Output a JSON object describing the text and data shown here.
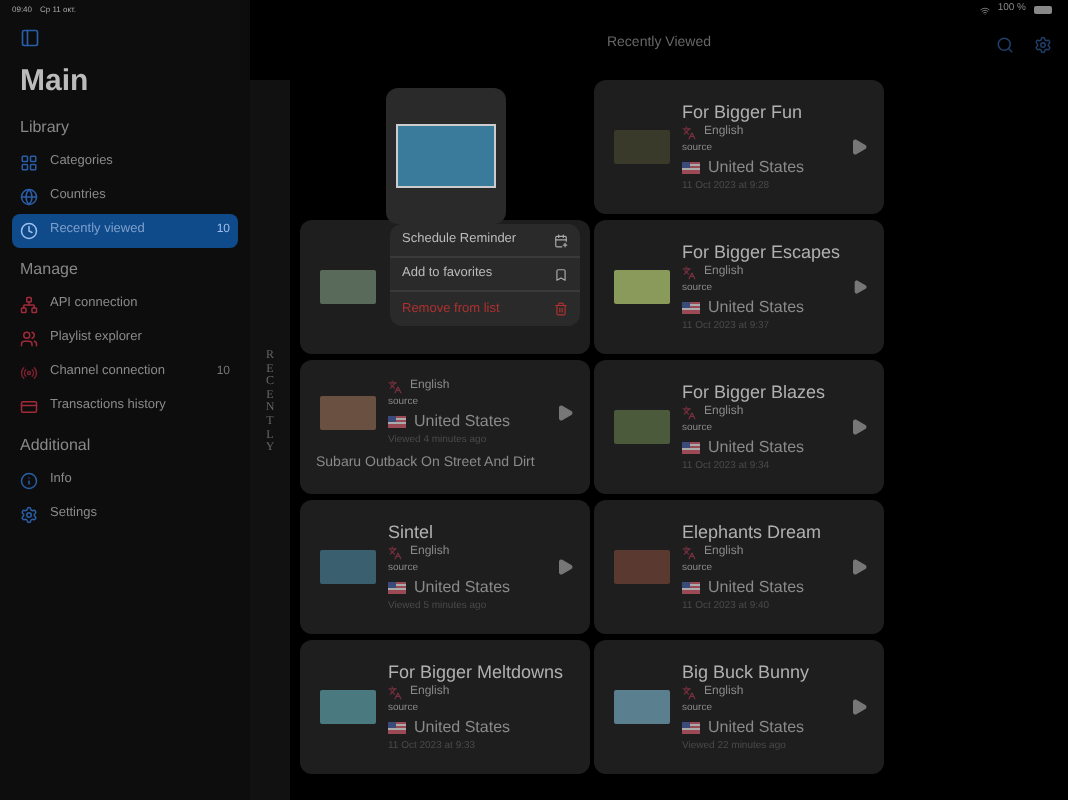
{
  "status_bar": {
    "time": "09:40",
    "date": "Ср 11 окт.",
    "battery": "100 %"
  },
  "sidebar": {
    "title": "Main",
    "sections": [
      {
        "heading": "Library",
        "items": [
          {
            "label": "Categories",
            "selected": false
          },
          {
            "label": "Countries",
            "selected": false
          },
          {
            "label": "Recently viewed",
            "badge": "10",
            "selected": true
          }
        ]
      },
      {
        "heading": "Manage",
        "items": [
          {
            "label": "API connection",
            "selected": false
          },
          {
            "label": "Playlist explorer",
            "selected": false
          },
          {
            "label": "Channel connection",
            "badge": "10",
            "selected": false
          },
          {
            "label": "Transactions history",
            "selected": false
          }
        ]
      },
      {
        "heading": "Additional",
        "items": [
          {
            "label": "Info",
            "selected": false
          },
          {
            "label": "Settings",
            "selected": false
          }
        ]
      }
    ]
  },
  "nav": {
    "title": "Recently Viewed"
  },
  "section_label": "RECENTLY",
  "context_menu": {
    "items": [
      {
        "label": "Schedule Reminder",
        "kind": "normal"
      },
      {
        "label": "Add to favorites",
        "kind": "normal"
      },
      {
        "label": "Remove from list",
        "kind": "destructive"
      }
    ]
  },
  "left_column": [
    {
      "kind": "covered"
    },
    {
      "kind": "captioned",
      "language": "English",
      "source_label": "source",
      "country": "United States",
      "viewed": "Viewed 4 minutes ago",
      "caption": "Subaru Outback On Street And Dirt"
    },
    {
      "kind": "video",
      "title": "Sintel",
      "language": "English",
      "source_label": "source",
      "country": "United States",
      "viewed": "Viewed 5 minutes ago"
    },
    {
      "kind": "video",
      "title": "For Bigger Meltdowns",
      "language": "English",
      "source_label": "source",
      "country": "United States",
      "viewed": "11 Oct 2023 at 9:33"
    }
  ],
  "right_column": [
    {
      "kind": "video",
      "title": "For Bigger Fun",
      "language": "English",
      "source_label": "source",
      "country": "United States",
      "viewed": "11 Oct 2023 at 9:28"
    },
    {
      "kind": "video",
      "title": "For Bigger Escapes",
      "language": "English",
      "source_label": "source",
      "country": "United States",
      "viewed": "11 Oct 2023 at 9:37"
    },
    {
      "kind": "video",
      "title": "For Bigger Blazes",
      "language": "English",
      "source_label": "source",
      "country": "United States",
      "viewed": "11 Oct 2023 at 9:34"
    },
    {
      "kind": "video",
      "title": "Elephants Dream",
      "language": "English",
      "source_label": "source",
      "country": "United States",
      "viewed": "11 Oct 2023 at 9:40"
    },
    {
      "kind": "video",
      "title": "Big Buck Bunny",
      "language": "English",
      "source_label": "source",
      "country": "United States",
      "viewed": "Viewed 22 minutes ago"
    }
  ]
}
